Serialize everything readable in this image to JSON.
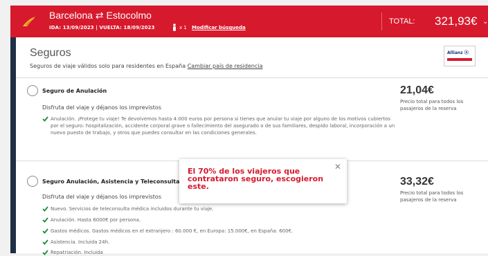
{
  "header": {
    "route": "Barcelona ⇄ Estocolmo",
    "dates": "IDA: 13/09/2023  |  VUELTA: 18/09/2023",
    "passengers": "x 1",
    "modify_label": "Modificar búsqueda",
    "total_label": "TOTAL:",
    "total_value": "321,93€",
    "colors": {
      "brand": "#d7192d",
      "sidebar": "#1f2f45",
      "check": "#1a8a3c"
    }
  },
  "section": {
    "title": "Seguros",
    "subtitle": "Seguros de viaje válidos solo para residentes en España",
    "change_country_link": "Cambiar país de residencia",
    "partner_logo_text": "Allianz ⓐ"
  },
  "options": [
    {
      "title": "Seguro de Anulación",
      "subtitle": "Disfruta del viaje y déjanos los imprevistos",
      "price": "21,04€",
      "price_note": "Precio total para todos los pasajeros de la reserva",
      "features": [
        "Anulación. ¡Protege tu viaje! Te devolvemos hasta 4.000 euros por persona si tienes que anular tu viaje por alguno de los motivos cubiertos por el seguro: hospitalización, accidente corporal grave o fallecimiento del asegurado o de sus familiares, despido laboral, incorporación a un nuevo puesto de trabajo, y otros que puedes consultar en las condiciones generales."
      ]
    },
    {
      "title": "Seguro Anulación, Asistencia y Teleconsulta",
      "subtitle": "Disfruta del viaje y déjanos los imprevistos",
      "price": "33,32€",
      "price_note": "Precio total para todos los pasajeros de la reserva",
      "features": [
        "Nuevo. Servicios de teleconsulta médica incluidos durante tu viaje.",
        "Anulación. Hasta 6000€ por persona.",
        "Gastos médicos. Gastos médicos en el extranjero : 60.000 €, en Europa: 15.000€, en España: 600€.",
        "Asistencia. Incluida 24h.",
        "Repatriación. Incluida"
      ]
    }
  ],
  "popup": {
    "message": "El 70% de los viajeros que contrataron seguro, escogieron este.",
    "close_label": "✕"
  }
}
